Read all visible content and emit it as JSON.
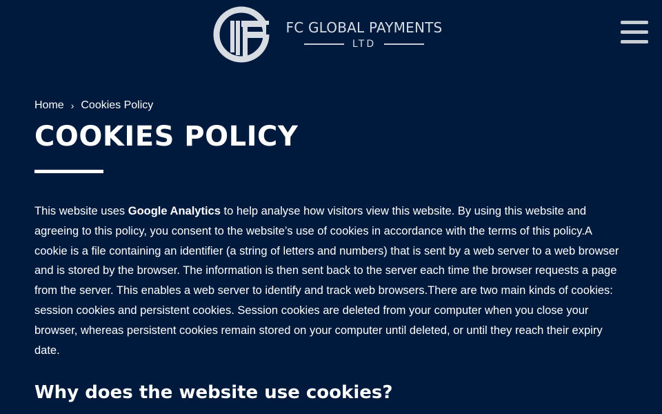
{
  "colors": {
    "background": "#001a3d",
    "text": "#ffffff",
    "logo": "#d7dbe2"
  },
  "header": {
    "logo_name": "FC GLOBAL PAYMENTS",
    "logo_sub": "LTD",
    "logo_icon": "fc-monogram-logo",
    "menu_icon": "hamburger-menu-icon"
  },
  "breadcrumb": {
    "home": "Home",
    "separator": "›",
    "current": "Cookies Policy"
  },
  "main": {
    "title": "COOKIES POLICY",
    "paragraph": {
      "before": "This website uses ",
      "bold": "Google Analytics",
      "after": " to help analyse how visitors view this website. By using this website and agreeing to this policy, you consent to the website’s use of cookies in accordance with the terms of this policy.A cookie is a file containing an identifier (a string of letters and numbers) that is sent by a web server to a web browser and is stored by the browser. The information is then sent back to the server each time the browser requests a page from the server. This enables a web server to identify and track web browsers.There are two main kinds of cookies: session cookies and persistent cookies. Session cookies are deleted from your computer when you close your browser, whereas persistent cookies remain stored on your computer until deleted, or until they reach their expiry date."
    },
    "section_heading": "Why does the website use cookies?"
  }
}
